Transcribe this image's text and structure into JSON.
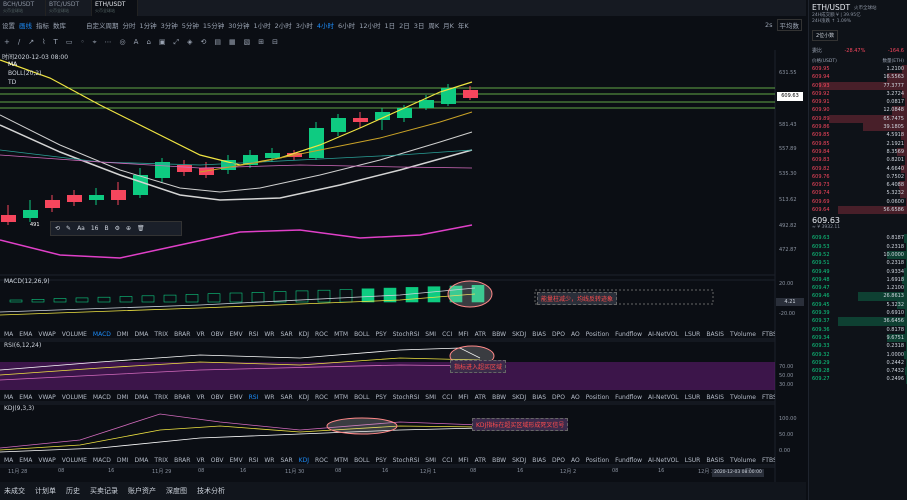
{
  "tabs": [
    {
      "name": "BCH/USDT",
      "sub": "火币全球站"
    },
    {
      "name": "BTC/USDT",
      "sub": "火币全球站"
    },
    {
      "name": "ETH/USDT",
      "sub": "火币全球站"
    }
  ],
  "toolbar": {
    "items": [
      "设置",
      "画线",
      "指标",
      "数库"
    ],
    "custom_period": "自定义周期",
    "periods": [
      "分时",
      "1分钟",
      "3分钟",
      "5分钟",
      "15分钟",
      "30分钟",
      "1小时",
      "2小时",
      "3小时",
      "4小时",
      "6小时",
      "12小时",
      "1日",
      "2日",
      "3日",
      "周K",
      "月K",
      "年K"
    ],
    "active_period": "4小时",
    "right": [
      "2s",
      "平均数"
    ]
  },
  "draw_tools": [
    "+",
    "/",
    "↗",
    "⌇",
    "T",
    "▭",
    "◦",
    "⌖",
    "⋯",
    "◎",
    "A",
    "⌂",
    "▣",
    "⤢",
    "◈",
    "⟲",
    "▤",
    "▦",
    "▧",
    "⊞",
    "⊟"
  ],
  "main": {
    "time_label": "时间2020-12-03 08:00",
    "legends": [
      "MA",
      "BOLL(20,2)",
      "TD"
    ],
    "price_labels": [
      "631.55",
      "609.63",
      "581.43",
      "557.89",
      "535.30",
      "513.62",
      "492.82",
      "472.87"
    ],
    "current_price": "609.63",
    "float_toolbar": [
      "⟲",
      "✎",
      "Aa",
      "16",
      "B",
      "⚙",
      "⊕",
      "🗑"
    ],
    "candle_low_label": "491"
  },
  "macd": {
    "legend": "MACD(12,26,9)",
    "y": [
      "20.00",
      "4.21",
      "-20.00"
    ],
    "note": "能量柱减少，均线反转迹象"
  },
  "indicator_row": [
    "MA",
    "EMA",
    "VWAP",
    "VOLUME",
    "MACD",
    "DMI",
    "DMA",
    "TRIX",
    "BRAR",
    "VR",
    "OBV",
    "EMV",
    "RSI",
    "WR",
    "SAR",
    "KDJ",
    "ROC",
    "MTM",
    "BOLL",
    "PSY",
    "StochRSI",
    "SMI",
    "CCI",
    "MFI",
    "ATR",
    "BBW",
    "SKDJ",
    "BIAS",
    "DPO",
    "AO",
    "Position",
    "Fundflow",
    "AI-NetVOL",
    "LSUR",
    "BASIS",
    "TVolume",
    "FTBS",
    "TTSI",
    "TTMU",
    "AI-BSI",
    "MLR"
  ],
  "rsi": {
    "legend": "RSI(6,12,24)",
    "y": [
      "70.00",
      "50.00",
      "30.00"
    ],
    "note": "指标进入超买区域"
  },
  "kdj": {
    "legend": "KDJ(9,3,3)",
    "y": [
      "100.00",
      "50.00",
      "0.00"
    ],
    "note": "KDJ指标在超买区域形成死叉信号"
  },
  "xaxis": [
    "11月 28",
    "08",
    "16",
    "11月 29",
    "08",
    "16",
    "11月 30",
    "08",
    "16",
    "12月 1",
    "08",
    "16",
    "12月 2",
    "08",
    "16",
    "12月 3",
    "08"
  ],
  "xaxis_cursor": "2020-12-03 08:00:00",
  "bottom_tabs": [
    "未成交",
    "计划单",
    "历史",
    "买卖记录",
    "账户资产",
    "深度图",
    "技术分析"
  ],
  "panel": {
    "pair": "ETH/USDT",
    "exchange": "火币全球站",
    "line1": "24H成交额 ¥ | 39.95亿",
    "line2": "24H涨跌 ↑ 1.09%",
    "depth_label": "2位小数",
    "ratio_label": "委比",
    "ratio_value": "-28.47%",
    "ratio_diff": "-164.6",
    "header_price": "价格(USDT)",
    "header_qty": "数量(ETH)",
    "asks": [
      [
        "609.95",
        "1.2100"
      ],
      [
        "609.94",
        "16.5563"
      ],
      [
        "609.93",
        "77.3777"
      ],
      [
        "609.92",
        "3.2724"
      ],
      [
        "609.91",
        "0.0817"
      ],
      [
        "609.90",
        "12.0848"
      ],
      [
        "609.89",
        "65.7475"
      ],
      [
        "609.86",
        "39.1805"
      ],
      [
        "609.85",
        "4.5918"
      ],
      [
        "609.85",
        "2.1921"
      ],
      [
        "609.84",
        "8.3569"
      ],
      [
        "609.83",
        "0.8201"
      ],
      [
        "609.82",
        "4.6640"
      ],
      [
        "609.76",
        "0.7502"
      ],
      [
        "609.73",
        "6.4088"
      ],
      [
        "609.74",
        "5.3232"
      ],
      [
        "609.69",
        "0.0600"
      ],
      [
        "609.64",
        "56.6586"
      ]
    ],
    "ask_fills": [
      0.05,
      0.2,
      0.9,
      0.05,
      0.02,
      0.15,
      0.8,
      0.45,
      0.06,
      0.03,
      0.1,
      0.02,
      0.06,
      0.02,
      0.08,
      0.07,
      0.01,
      0.7
    ],
    "last_price": "609.63",
    "last_cny": "≈ ¥ 3932.11",
    "bids": [
      [
        "609.63",
        "0.8187"
      ],
      [
        "609.53",
        "0.2318"
      ],
      [
        "609.52",
        "10.0000"
      ],
      [
        "609.51",
        "0.2318"
      ],
      [
        "609.49",
        "0.9334"
      ],
      [
        "609.48",
        "1.6918"
      ],
      [
        "609.47",
        "1.2100"
      ],
      [
        "609.46",
        "26.8613"
      ],
      [
        "609.45",
        "5.3232"
      ],
      [
        "609.39",
        "0.6910"
      ],
      [
        "609.37",
        "36.6456"
      ],
      [
        "609.36",
        "0.8178"
      ],
      [
        "609.34",
        "9.6751"
      ],
      [
        "609.33",
        "0.2318"
      ],
      [
        "609.32",
        "1.0000"
      ],
      [
        "609.29",
        "0.2442"
      ],
      [
        "609.28",
        "0.7432"
      ],
      [
        "609.27",
        "0.2496"
      ]
    ],
    "bid_fills": [
      0.03,
      0.01,
      0.2,
      0.01,
      0.03,
      0.05,
      0.03,
      0.5,
      0.1,
      0.02,
      0.7,
      0.02,
      0.2,
      0.01,
      0.03,
      0.01,
      0.02,
      0.01
    ]
  },
  "colors": {
    "up": "#0ecb81",
    "down": "#f6465d",
    "accent": "#1d8cf8",
    "ma1": "#f0e442",
    "ma2": "#d4d4d4",
    "boll_mid": "#c9a227",
    "boll_lower": "#e040c8"
  }
}
